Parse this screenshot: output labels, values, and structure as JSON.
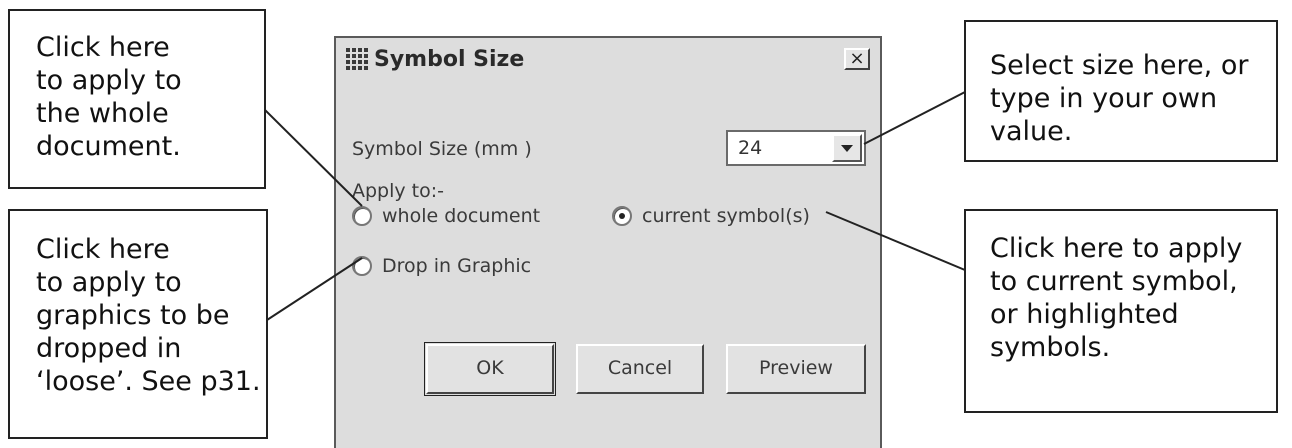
{
  "dialog": {
    "title": "Symbol Size",
    "close_label": "×",
    "size_label": "Symbol Size (mm )",
    "size_value": "24",
    "apply_label": "Apply to:-",
    "options": [
      {
        "label": "whole document",
        "checked": false
      },
      {
        "label": "current symbol(s)",
        "checked": true
      },
      {
        "label": "Drop in Graphic",
        "checked": false
      }
    ],
    "buttons": {
      "ok": "OK",
      "cancel": "Cancel",
      "preview": "Preview"
    }
  },
  "callouts": {
    "whole_document": [
      "Click here",
      "to apply to",
      "the whole",
      "document."
    ],
    "drop_in_graphic": [
      "Click here",
      "to apply to",
      "graphics to be",
      "dropped in",
      "‘loose’. See p31."
    ],
    "size": [
      "Select size here, or",
      "type in your own",
      "value."
    ],
    "current_symbol": [
      "Click here to apply",
      "to current symbol,",
      "or highlighted",
      "symbols."
    ]
  }
}
